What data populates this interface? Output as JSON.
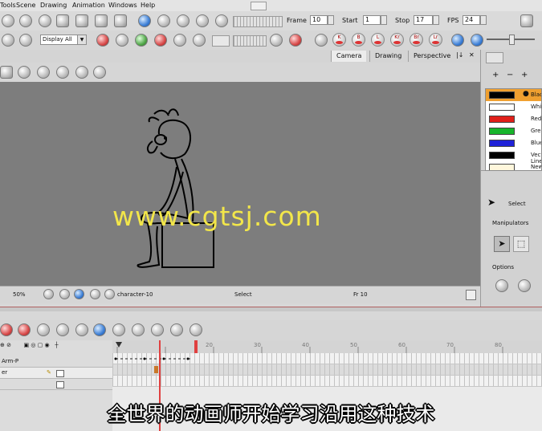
{
  "menu": [
    "Tools",
    "Scene",
    "Drawing",
    "Animation",
    "Windows",
    "Help"
  ],
  "playback": {
    "frame_label": "Frame",
    "frame_value": "10",
    "start_label": "Start",
    "start_value": "1",
    "stop_label": "Stop",
    "stop_value": "17",
    "fps_label": "FPS",
    "fps_value": "24"
  },
  "display_select": "Display All",
  "pen_keys": [
    "K",
    "B",
    "L",
    "Kr",
    "Br",
    "Lr"
  ],
  "view_tabs": [
    "Camera",
    "Drawing",
    "Perspective"
  ],
  "status": {
    "zoom": "50%",
    "drawing_name": "character-10",
    "tool": "Select",
    "frame": "Fr 10"
  },
  "palette": {
    "colors": [
      {
        "name": "Black",
        "hex": "#000000",
        "selected": true
      },
      {
        "name": "White",
        "hex": "#ffffff"
      },
      {
        "name": "Red",
        "hex": "#e0201a"
      },
      {
        "name": "Green",
        "hex": "#17b52b"
      },
      {
        "name": "Blue",
        "hex": "#1f22d8"
      },
      {
        "name": "Vectorized Line",
        "hex": "#000000"
      },
      {
        "name": "New",
        "hex": "#fff7dc"
      }
    ]
  },
  "tool_properties": {
    "tool_name": "Select",
    "manipulators_label": "Manipulators",
    "options_label": "Options"
  },
  "timeline": {
    "layers": [
      "Arm-P",
      "er",
      ""
    ],
    "ruler_ticks": [
      "20",
      "30",
      "40",
      "50",
      "60",
      "70",
      "80"
    ],
    "current_frame": 10
  },
  "watermark": "www.cgtsj.com",
  "subtitle": "全世界的动画师开始学习沿用这种技术",
  "accent": "#e04040"
}
